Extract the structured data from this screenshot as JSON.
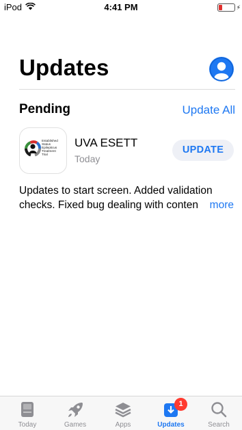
{
  "status_bar": {
    "carrier": "iPod",
    "time": "4:41 PM"
  },
  "header": {
    "title": "Updates"
  },
  "pending": {
    "title": "Pending",
    "update_all_label": "Update All",
    "app": {
      "name": "UVA ESETT",
      "date": "Today",
      "button_label": "UPDATE",
      "icon_text": [
        "Established",
        "Status",
        "Epilepticus",
        "Treatment",
        "Trial"
      ],
      "release_notes_line1": "Updates to start screen. Added validation",
      "release_notes_line2": "checks. Fixed bug dealing with content",
      "more_label": "more"
    }
  },
  "tab_bar": {
    "tabs": [
      {
        "label": "Today",
        "icon": "today-icon"
      },
      {
        "label": "Games",
        "icon": "rocket-icon"
      },
      {
        "label": "Apps",
        "icon": "layers-icon"
      },
      {
        "label": "Updates",
        "icon": "download-icon",
        "badge": "1"
      },
      {
        "label": "Search",
        "icon": "search-icon"
      }
    ],
    "active": "Updates"
  },
  "colors": {
    "accent": "#1e78f2",
    "badge": "#ff3b30",
    "inactive": "#8e8e93"
  }
}
